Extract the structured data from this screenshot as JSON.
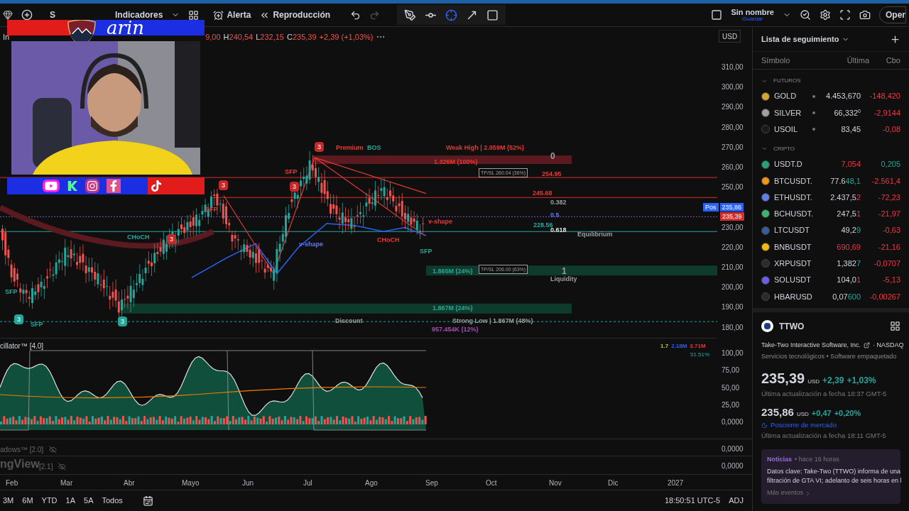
{
  "toolbar": {
    "symbol": "S",
    "indicators": "Indicadores",
    "alert": "Alerta",
    "replay": "Reproducción",
    "tools": [
      {
        "kind": "brush",
        "selected": false
      },
      {
        "kind": "line",
        "selected": false
      },
      {
        "kind": "cross",
        "selected": true
      },
      {
        "kind": "arrow",
        "selected": false
      },
      {
        "kind": "frame",
        "selected": false
      }
    ],
    "layout_name": "Sin nombre",
    "save": "Guardar",
    "trade_button": "Oper"
  },
  "overlay": {
    "brand": "arin"
  },
  "legend": {
    "prefix": "In",
    "values": [
      {
        "value": "9,00"
      },
      {
        "label": "H",
        "value": "240,54"
      },
      {
        "label": "L",
        "value": "232,15"
      },
      {
        "label": "C",
        "value": "235,39"
      }
    ],
    "change": "+2,39 (+1,03%)",
    "currency": "USD"
  },
  "annotations": [
    {
      "kind": "badge",
      "text": "3",
      "color": "#c62828"
    },
    {
      "kind": "label",
      "text": "Premium",
      "color": "#e53935"
    },
    {
      "kind": "label",
      "text": "BOS",
      "color": "#26a69a"
    },
    {
      "kind": "label",
      "text": "Weak High | 2.059M (52%)",
      "color": "#e53935"
    },
    {
      "kind": "label",
      "text": "0",
      "color": "#9e9e9e"
    },
    {
      "kind": "label",
      "text": "1.326M (100%)",
      "color": "#e53935"
    },
    {
      "kind": "label",
      "text": "SFP",
      "color": "#e53935"
    },
    {
      "kind": "tag",
      "text": "TP/SL 260.04 (36%)",
      "color": "#9e9e9e"
    },
    {
      "kind": "label",
      "text": "254.95",
      "color": "#e53935"
    },
    {
      "kind": "badge",
      "text": "3",
      "color": "#c62828"
    },
    {
      "kind": "badge",
      "text": "3",
      "color": "#c62828"
    },
    {
      "kind": "label",
      "text": "245.68",
      "color": "#e53935"
    },
    {
      "kind": "label",
      "text": "0.382",
      "color": "#9e9e9e"
    },
    {
      "kind": "label",
      "text": "SFP",
      "color": "#e53935"
    },
    {
      "kind": "label",
      "text": "0.5",
      "color": "#5c7cfa"
    },
    {
      "kind": "label",
      "text": "v-shape",
      "color": "#e53935"
    },
    {
      "kind": "label",
      "text": "228.56",
      "color": "#26a69a"
    },
    {
      "kind": "label",
      "text": "0.618",
      "color": "#e0e0e0"
    },
    {
      "kind": "label",
      "text": "Equilibrium",
      "color": "#9e9e9e"
    },
    {
      "kind": "label",
      "text": "CHoCH",
      "color": "#26a69a"
    },
    {
      "kind": "badge",
      "text": "3",
      "color": "#c62828"
    },
    {
      "kind": "label",
      "text": "v-shape",
      "color": "#5c7cfa"
    },
    {
      "kind": "label",
      "text": "CHoCH",
      "color": "#e53935"
    },
    {
      "kind": "label",
      "text": "SFP",
      "color": "#26a69a"
    },
    {
      "kind": "label",
      "text": "1.865M (24%)",
      "color": "#26a69a"
    },
    {
      "kind": "tag",
      "text": "TP/SL 206.00 (63%)",
      "color": "#9e9e9e"
    },
    {
      "kind": "label",
      "text": "1",
      "color": "#9e9e9e"
    },
    {
      "kind": "label",
      "text": "Liquidity",
      "color": "#9e9e9e"
    },
    {
      "kind": "label",
      "text": "SFP",
      "color": "#26a69a"
    },
    {
      "kind": "label",
      "text": "1.867M (24%)",
      "color": "#26a69a"
    },
    {
      "kind": "badge",
      "text": "3",
      "color": "#26a69a"
    },
    {
      "kind": "badge",
      "text": "3",
      "color": "#26a69a"
    },
    {
      "kind": "label",
      "text": "Discount",
      "color": "#9e9e9e"
    },
    {
      "kind": "label",
      "text": "Strong Low | 1.867M (48%)",
      "color": "#9e9e9e"
    },
    {
      "kind": "label",
      "text": "SFP",
      "color": "#26a69a"
    },
    {
      "kind": "label",
      "text": "957.454K (12%)",
      "color": "#ab47bc"
    }
  ],
  "price_axis": [
    "310,00",
    "300,00",
    "290,00",
    "280,00",
    "270,00",
    "260,00",
    "250,00",
    "230,00",
    "220,00",
    "210,00",
    "200,00",
    "190,00",
    "180,00"
  ],
  "price_tags": [
    {
      "kind": "post",
      "label": "Pos",
      "value": "235,86"
    },
    {
      "kind": "last",
      "value": "235,39"
    }
  ],
  "oscillator": {
    "title": "cillator™ [4.0]",
    "stats": [
      {
        "text": "1.7",
        "color": "#c0ca33"
      },
      {
        "text": "2.18M",
        "color": "#2962ff"
      },
      {
        "text": "3.71M",
        "color": "#e53935"
      }
    ],
    "percent": "51.51%",
    "axis": [
      "100,00",
      "75,00",
      "50,00",
      "25,00",
      "0,0000"
    ]
  },
  "hidden_indicators": [
    {
      "title": "adows™ [2.0]",
      "axis": "0,0000"
    },
    {
      "title": "[2.1]",
      "axis": "0,0000"
    }
  ],
  "chart_watermark": "ngView",
  "time_axis": [
    "Feb",
    "Mar",
    "Abr",
    "Mayo",
    "Jun",
    "Jul",
    "Ago",
    "Sep",
    "Oct",
    "Nov",
    "Dic",
    "2027"
  ],
  "ranges": [
    {
      "label": "3M"
    },
    {
      "label": "6M"
    },
    {
      "label": "YTD"
    },
    {
      "label": "1A"
    },
    {
      "label": "5A"
    },
    {
      "label": "Todos"
    }
  ],
  "clock": "18:50:51 UTC-5",
  "adj": "ADJ",
  "watchlist": {
    "title": "Lista de seguimiento",
    "columns": [
      "Símbolo",
      "Última",
      "Cbo"
    ],
    "groups": [
      {
        "name": "FUTUROS",
        "expanded": true,
        "items": [
          {
            "symbol": "GOLD",
            "live": true,
            "color": "#d4a72c",
            "last": "4.453,670",
            "change": "-148,420",
            "change_up": false
          },
          {
            "symbol": "SILVER",
            "live": true,
            "color": "#a0a0a0",
            "last": "66,332",
            "sup": "0",
            "change": "-2,9144",
            "change_up": false
          },
          {
            "symbol": "USOIL",
            "live": true,
            "color": "#1a1a1a",
            "last": "83,45",
            "change": "-0,08",
            "change_up": false
          }
        ]
      },
      {
        "name": "CRIPTO",
        "expanded": true,
        "items": [
          {
            "symbol": "USDT.D",
            "live": false,
            "color": "#26a17b",
            "flash": "7,054",
            "flash_up": false,
            "change": "0,205",
            "change_up": true
          },
          {
            "symbol": "BTCUSDT.",
            "live": false,
            "color": "#f7931a",
            "last": "77.6",
            "flash": "48,1",
            "flash_up": true,
            "change": "-2.561,4",
            "change_up": false
          },
          {
            "symbol": "ETHUSDT.",
            "live": false,
            "color": "#627eea",
            "last": "2.437,5",
            "flash": "2",
            "flash_up": false,
            "change": "-72,23",
            "change_up": false
          },
          {
            "symbol": "BCHUSDT.",
            "live": false,
            "color": "#3cb371",
            "last": "247,5",
            "flash": "1",
            "flash_up": false,
            "change": "-21,97",
            "change_up": false
          },
          {
            "symbol": "LTCUSDT",
            "live": false,
            "color": "#345d9d",
            "last": "49,2",
            "flash": "9",
            "flash_up": true,
            "change": "-0,63",
            "change_up": false
          },
          {
            "symbol": "BNBUSDT",
            "live": false,
            "color": "#f0b90b",
            "flash": "690,69",
            "flash_up": false,
            "change": "-21,16",
            "change_up": false
          },
          {
            "symbol": "XRPUSDT",
            "live": false,
            "color": "#2b2b2b",
            "last": "1,382",
            "flash": "7",
            "flash_up": true,
            "change": "-0,0707",
            "change_up": false
          },
          {
            "symbol": "SOLUSDT",
            "live": false,
            "color": "#6b5cf0",
            "last": "104,0",
            "flash": "1",
            "flash_up": false,
            "change": "-5,13",
            "change_up": false
          },
          {
            "symbol": "HBARUSD",
            "live": false,
            "color": "#2b2b2b",
            "last": "0,07",
            "flash": "600",
            "flash_up": true,
            "change": "-0,00267",
            "change_up": false
          }
        ]
      }
    ]
  },
  "details": {
    "ticker": "TTWO",
    "company": "Take-Two Interactive Software, Inc.",
    "exchange": "· NASDAQ",
    "sector": "Servicios tecnológicos • Software empaquetado",
    "price": "235,39",
    "currency": "USD",
    "change": "+2,39",
    "change_pct": "+1,03%",
    "updated": "Última actualización a fecha 18:37 GMT-5",
    "post_price": "235,86",
    "post_currency": "USD",
    "post_change": "+0,47",
    "post_change_pct": "+0,20%",
    "post_label": "Poscierre de mercado",
    "post_updated": "Última actualización a fecha 18:11 GMT-5",
    "news": {
      "label": "Noticias",
      "age": "• hace 16 horas",
      "headline": "Datos clave: Take-Two (TTWO) informa de una filtración de GTA VI; adelanto de seis horas en l",
      "more": "Más eventos"
    }
  }
}
